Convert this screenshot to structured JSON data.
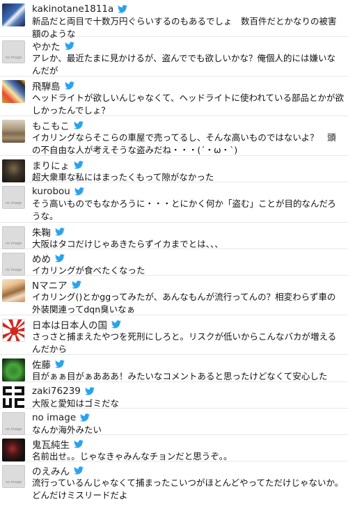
{
  "comments": [
    {
      "name": "kakinotane1811a",
      "text": "新品だと両目で十数万円ぐらいするのもあるでしょ　数百件だとかなりの被害額のような",
      "avatar": "photo-dark-blue"
    },
    {
      "name": "やかた",
      "text": "アレか、最近たまに見かけるが、盗んででも欲しいかな？俺個人的には嫌いなんだが",
      "avatar": "no-image",
      "noimage_label": "no image"
    },
    {
      "name": "飛騨島",
      "text": "ヘッドライトが欲しいんじゃなくて、ヘッドライトに使われている部品とかが欲しかったんでしょ？",
      "avatar": "anime-colorful"
    },
    {
      "name": "もこもこ",
      "text": "イカリングならそこらの車屋で売ってるし、そんな高いものではないよ？　頭の不自由な人が考えそうな盗みだね・・・(´・ω・`)",
      "avatar": "photo-landscape"
    },
    {
      "name": "まりにょ",
      "text": "超大衆車な私にはまったくもって隙がなかった",
      "avatar": "dark-photo"
    },
    {
      "name": "kurobou",
      "text": "そう高いものでもなかろうに・・・とにかく何か「盗む」ことが目的なんだろうな。",
      "avatar": "no-image",
      "noimage_label": "no image"
    },
    {
      "name": "朱鞠",
      "text": "大阪はタコだけじゃあきたらずイカまでとは、、、",
      "avatar": "no-image",
      "noimage_label": "no image"
    },
    {
      "name": "めめ",
      "text": "イカリングが食べたくなった",
      "avatar": "no-image",
      "noimage_label": "no image"
    },
    {
      "name": "Nマニア",
      "text": "イカリング()とかggってみたが、あんなもんが流行ってんの？相変わらず車の外装関連ってdqn臭いなぁ",
      "avatar": "anime-girl"
    },
    {
      "name": "日本は日本人の国",
      "text": "さっさと捕まえたやつを死刑にしろと。リスクが低いからこんなバカが増えるんだから",
      "avatar": "rising-sun-flag"
    },
    {
      "name": "佐藤",
      "text": "目がぁぁ目がぁあああ！みたいなコメントあると思ったけどなくて安心した",
      "avatar": "green-character"
    },
    {
      "name": "zaki76239",
      "text": "大阪と愛知はゴミだな",
      "avatar": "black-white-logo"
    },
    {
      "name": "no image",
      "text": "なんか海外みたい",
      "avatar": "no-image",
      "noimage_label": "no image"
    },
    {
      "name": "鬼瓦純生",
      "text": "名前出せ。。じゃなきゃみんなチョンだと思うぞ。。",
      "avatar": "dark-red-photo"
    },
    {
      "name": "のえみん",
      "text": "流行っているんじゃなくて捕まったこいつがほとんどやってただけじゃないか。どんだけミスリードだよ",
      "avatar": "no-image",
      "noimage_label": "no image"
    }
  ],
  "colors": {
    "twitter_bird": "#2aa3ef",
    "noimage_bg": "#dcdcdc",
    "divider": "#e8e8e8"
  },
  "icons": {
    "bird": "twitter-bird-icon"
  }
}
